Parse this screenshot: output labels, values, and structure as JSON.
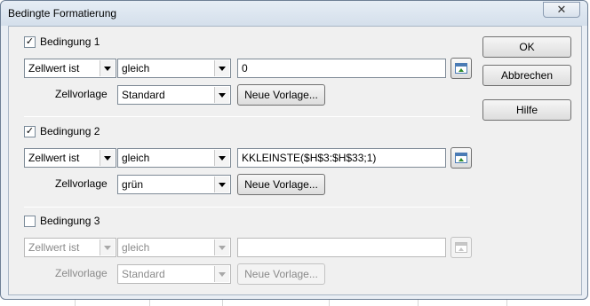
{
  "window": {
    "title": "Bedingte Formatierung",
    "close_glyph": "✕"
  },
  "conditions": [
    {
      "enabled": true,
      "check_glyph": "✓",
      "label": "Bedingung 1",
      "type": "Zellwert ist",
      "operator": "gleich",
      "value": "0",
      "style_label": "Zellvorlage",
      "style": "Standard",
      "new_style_label": "Neue Vorlage..."
    },
    {
      "enabled": true,
      "check_glyph": "✓",
      "label": "Bedingung 2",
      "type": "Zellwert ist",
      "operator": "gleich",
      "value": "KKLEINSTE($H$3:$H$33;1)",
      "style_label": "Zellvorlage",
      "style": "grün",
      "new_style_label": "Neue Vorlage..."
    },
    {
      "enabled": false,
      "check_glyph": "",
      "label": "Bedingung 3",
      "type": "Zellwert ist",
      "operator": "gleich",
      "value": "",
      "style_label": "Zellvorlage",
      "style": "Standard",
      "new_style_label": "Neue Vorlage..."
    }
  ],
  "buttons": {
    "ok": "OK",
    "cancel": "Abbrechen",
    "help": "Hilfe"
  },
  "icons": {
    "shrink": "shrink-dialog-icon"
  }
}
